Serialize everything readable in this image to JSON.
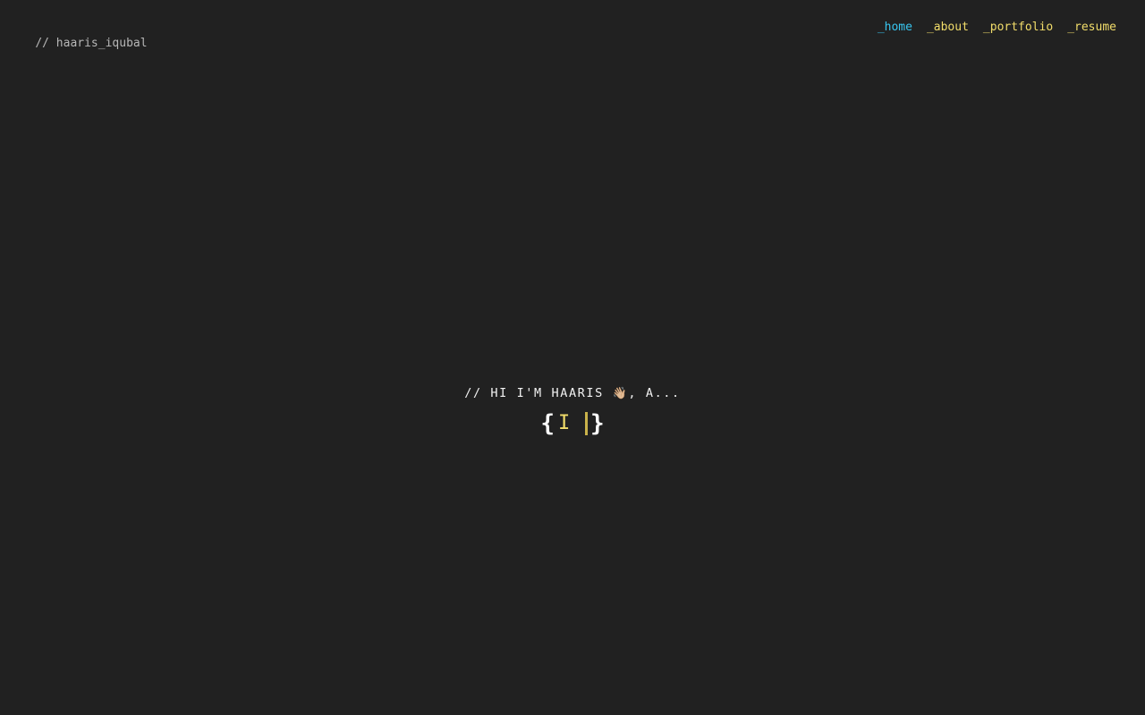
{
  "header": {
    "brand_prefix": "//",
    "brand_name": "haaris_iqubal"
  },
  "nav": {
    "items": [
      {
        "label": "_home",
        "active": true
      },
      {
        "label": "_about",
        "active": false
      },
      {
        "label": "_portfolio",
        "active": false
      },
      {
        "label": "_resume",
        "active": false
      }
    ]
  },
  "hero": {
    "greeting": "// HI I'M HAARIS ",
    "wave_emoji": "👋🏼",
    "greeting_suffix": ", A...",
    "open_brace": "{",
    "typed_text": "I",
    "close_brace": "}"
  },
  "colors": {
    "background": "#212121",
    "nav_link": "#f2dd6a",
    "nav_active": "#38c6f0",
    "typed_accent": "#f2dd6a"
  }
}
